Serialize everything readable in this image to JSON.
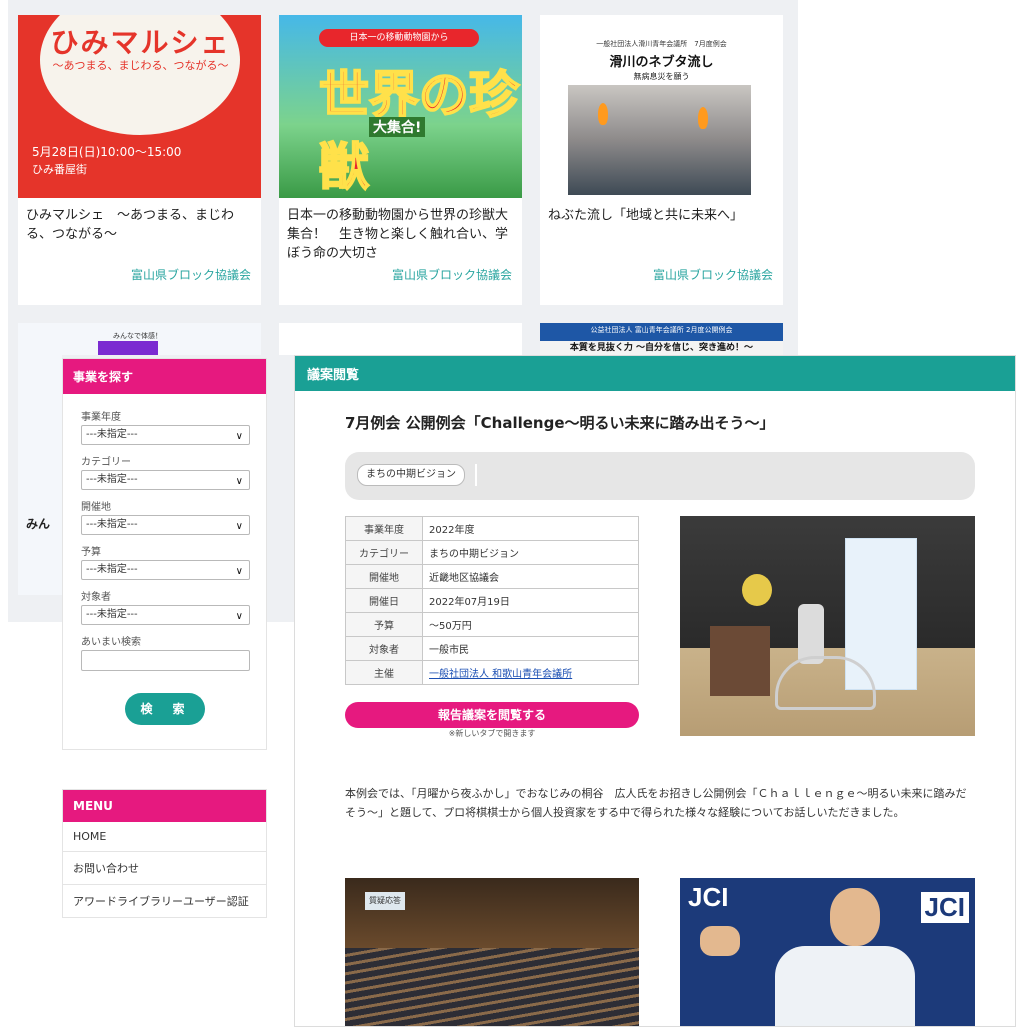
{
  "cards": [
    {
      "title": "ひみマルシェ　～あつまる、まじわる、つながる～",
      "org": "富山県ブロック協議会",
      "thumb": {
        "heading": "ひみマルシェ",
        "subheading": "～あつまる、まじわる、つながる～",
        "date": "5月28日(日)10:00～15:00",
        "place": "ひみ番屋街"
      }
    },
    {
      "title": "日本一の移動動物園から世界の珍獣大集合！　生き物と楽しく触れ合い、学ぼう命の大切さ",
      "org": "富山県ブロック協議会",
      "thumb": {
        "banner": "日本一の移動動物園から",
        "heading": "世界の珍獣",
        "caption": "大集合!"
      }
    },
    {
      "title": "ねぶた流し「地域と共に未来へ」",
      "org": "富山県ブロック協議会",
      "thumb": {
        "line1": "一般社団法人滑川青年会議所　7月度例会",
        "line2": "滑川のネブタ流し",
        "line3": "無病息災を願う"
      }
    }
  ],
  "row2": {
    "left_caption": "みんなで体感！",
    "left_partial": "みん",
    "right_line1": "公益社団法人 富山青年会議所 2月度公開例会",
    "right_line2": "本質を見抜く力 ～自分を信じ、突き進め！～"
  },
  "search_panel": {
    "heading": "事業を探す",
    "fields": [
      {
        "label": "事業年度",
        "value": "---未指定---"
      },
      {
        "label": "カテゴリー",
        "value": "---未指定---"
      },
      {
        "label": "開催地",
        "value": "---未指定---"
      },
      {
        "label": "予算",
        "value": "---未指定---"
      },
      {
        "label": "対象者",
        "value": "---未指定---"
      }
    ],
    "fuzzy_label": "あいまい検索",
    "fuzzy_value": "",
    "search_button": "検　索"
  },
  "menu": {
    "heading": "MENU",
    "items": [
      "HOME",
      "お問い合わせ",
      "アワードライブラリーユーザー認証"
    ]
  },
  "main": {
    "header": "議案閲覧",
    "title": "7月例会 公開例会「Challenge～明るい未来に踏み出そう～」",
    "tag": "まちの中期ビジョン",
    "info": [
      {
        "key": "事業年度",
        "value": "2022年度"
      },
      {
        "key": "カテゴリー",
        "value": "まちの中期ビジョン"
      },
      {
        "key": "開催地",
        "value": "近畿地区協議会"
      },
      {
        "key": "開催日",
        "value": "2022年07月19日"
      },
      {
        "key": "予算",
        "value": "～50万円"
      },
      {
        "key": "対象者",
        "value": "一般市民"
      },
      {
        "key": "主催",
        "value": "一般社団法人 和歌山青年会議所"
      }
    ],
    "report_button": "報告議案を閲覧する",
    "report_note": "※新しいタブで開きます",
    "body": "本例会では、「月曜から夜ふかし」でおなじみの桐谷　広人氏をお招きし公開例会「Ｃｈａｌｌｅｎｇｅ～明るい未来に踏みだそう～」と題して、プロ将棋棋士から個人投資家をする中で得られた様々な経験についてお話しいただきました。",
    "photo_b1_caption": "質疑応答",
    "photo_b2_logo": "JCI"
  },
  "colors": {
    "accent_pink": "#e6197f",
    "accent_teal": "#1aa095",
    "org_text": "#2aa5a0"
  }
}
